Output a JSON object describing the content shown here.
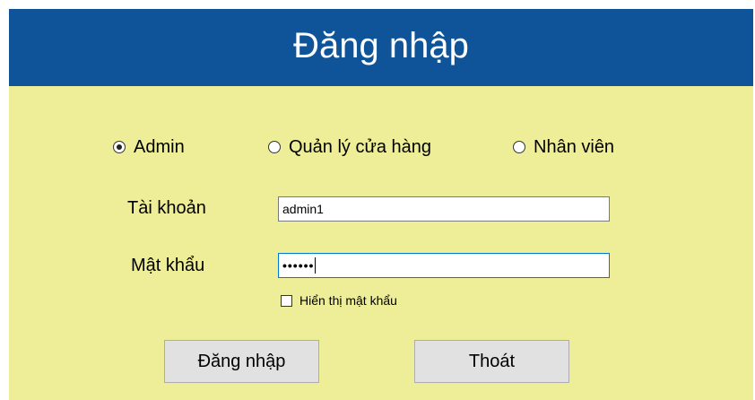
{
  "form": {
    "title": "Đăng nhập",
    "colors": {
      "header": "#0f5499",
      "background": "#eeee99"
    }
  },
  "role": {
    "selected": "Admin",
    "options": [
      {
        "label": "Admin",
        "checked": true
      },
      {
        "label": "Quản lý cửa hàng",
        "checked": false
      },
      {
        "label": "Nhân viên",
        "checked": false
      }
    ]
  },
  "fields": {
    "username_label": "Tài khoản",
    "username_value": "admin1",
    "password_label": "Mật khẩu",
    "password_value": "••••••"
  },
  "show_password": {
    "label": "Hiển thị mật khẩu",
    "checked": false
  },
  "buttons": {
    "login": "Đăng nhập",
    "exit": "Thoát"
  }
}
